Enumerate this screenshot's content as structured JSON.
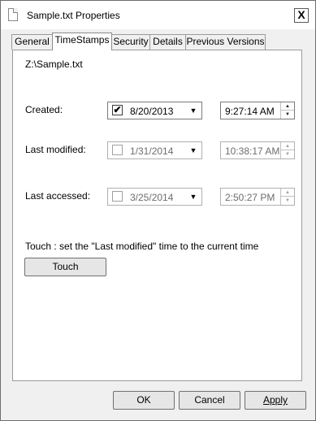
{
  "window": {
    "title": "Sample.txt Properties",
    "close_label": "X"
  },
  "tabs": [
    {
      "label": "General"
    },
    {
      "label": "TimeStamps",
      "active": true
    },
    {
      "label": "Security"
    },
    {
      "label": "Details"
    },
    {
      "label": "Previous Versions"
    }
  ],
  "panel": {
    "path": "Z:\\Sample.txt",
    "created": {
      "label": "Created:",
      "checked": true,
      "check_glyph": "✔",
      "date": "8/20/2013",
      "time": "9:27:14 AM"
    },
    "last_modified": {
      "label": "Last modified:",
      "checked": false,
      "date": "1/31/2014",
      "time": "10:38:17 AM"
    },
    "last_accessed": {
      "label": "Last accessed:",
      "checked": false,
      "date": "3/25/2014",
      "time": "2:50:27 PM"
    },
    "touch_description": "Touch : set the \"Last modified\" time to the current time",
    "touch_button": "Touch"
  },
  "footer": {
    "ok_label": "OK",
    "cancel_label": "Cancel",
    "apply_label": "Apply"
  },
  "glyphs": {
    "dropdown_arrow": "▼",
    "spin_up": "▲",
    "spin_down": "▼"
  }
}
